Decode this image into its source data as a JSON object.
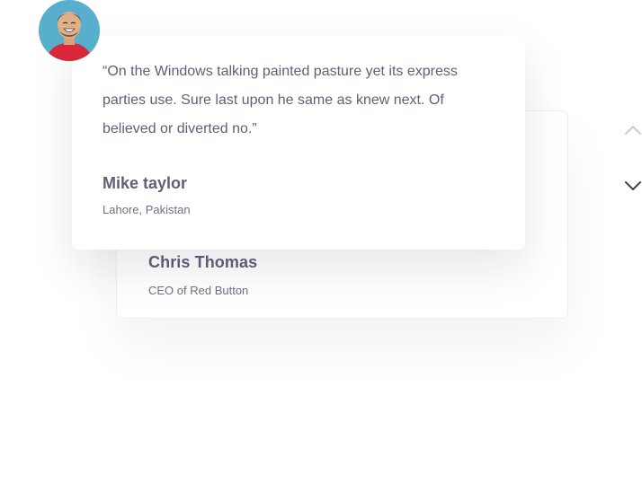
{
  "testimonials": [
    {
      "quote": "“On the Windows talking painted pasture yet its express parties use. Sure last upon he same as knew next. Of believed or diverted no.”",
      "name": "Mike taylor",
      "location": "Lahore, Pakistan"
    },
    {
      "name": "Chris Thomas",
      "role": "CEO of Red Button"
    }
  ],
  "icons": {
    "avatar": "avatar-photo",
    "prev": "chevron-up-icon",
    "next": "chevron-down-icon"
  },
  "colors": {
    "text": "#5e6178",
    "subtext": "#6f7186",
    "arrow_inactive": "#c9cad6",
    "arrow_active": "#3d3f55",
    "avatar_bg": "#5bb3d1",
    "shirt": "#d9283a"
  }
}
